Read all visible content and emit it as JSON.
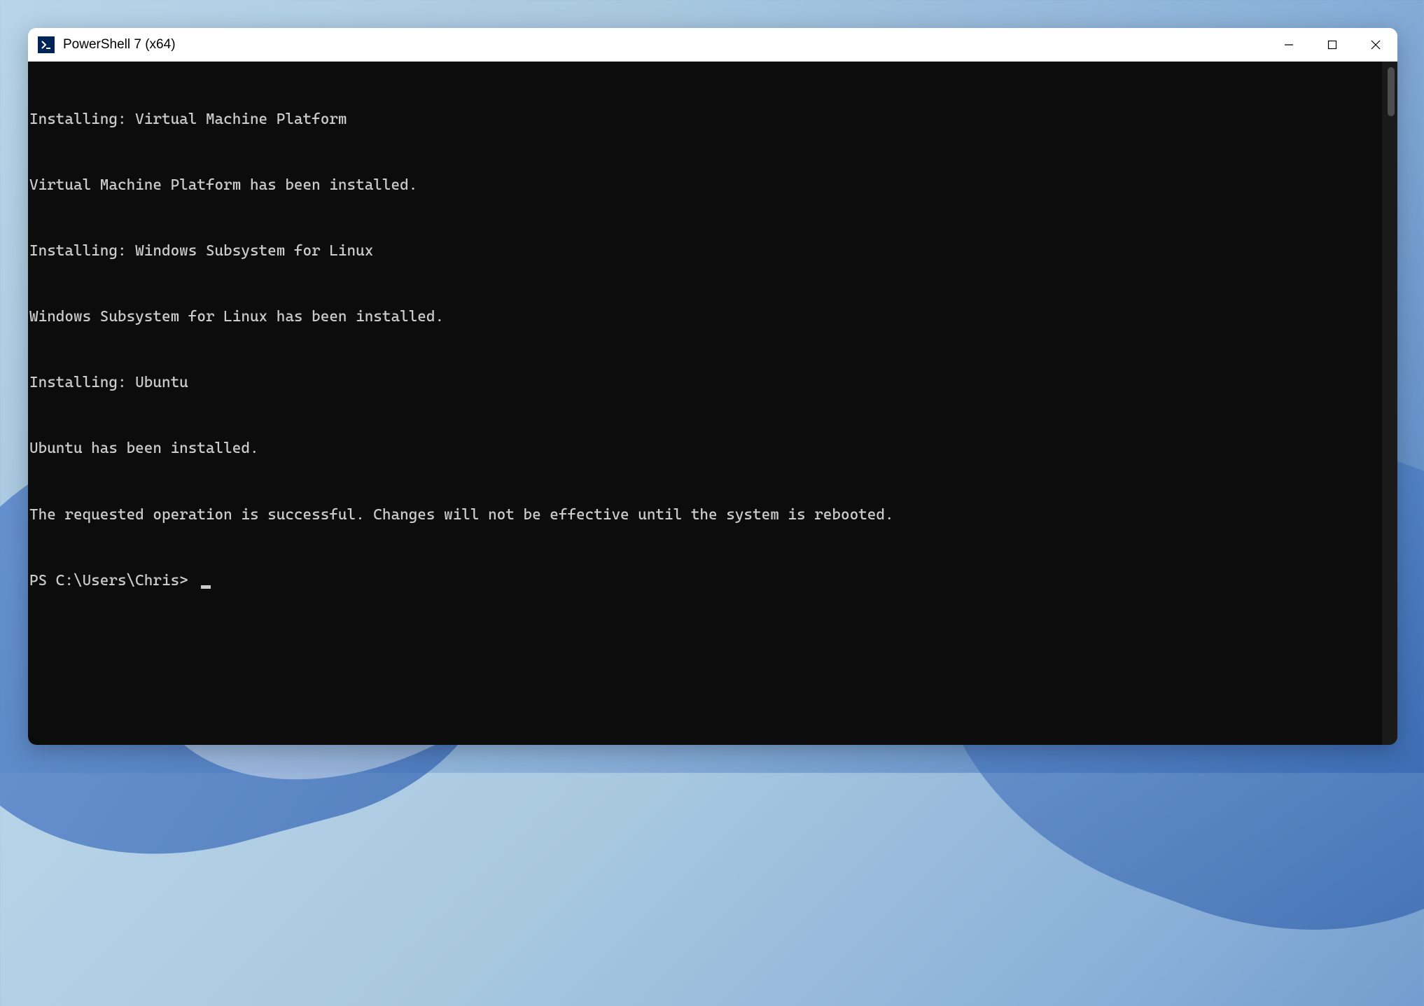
{
  "window": {
    "title": "PowerShell 7 (x64)",
    "app_icon_glyph": ">_"
  },
  "terminal": {
    "lines": [
      "Installing: Virtual Machine Platform",
      "Virtual Machine Platform has been installed.",
      "Installing: Windows Subsystem for Linux",
      "Windows Subsystem for Linux has been installed.",
      "Installing: Ubuntu",
      "Ubuntu has been installed.",
      "The requested operation is successful. Changes will not be effective until the system is rebooted."
    ],
    "prompt": "PS C:\\Users\\Chris> "
  }
}
